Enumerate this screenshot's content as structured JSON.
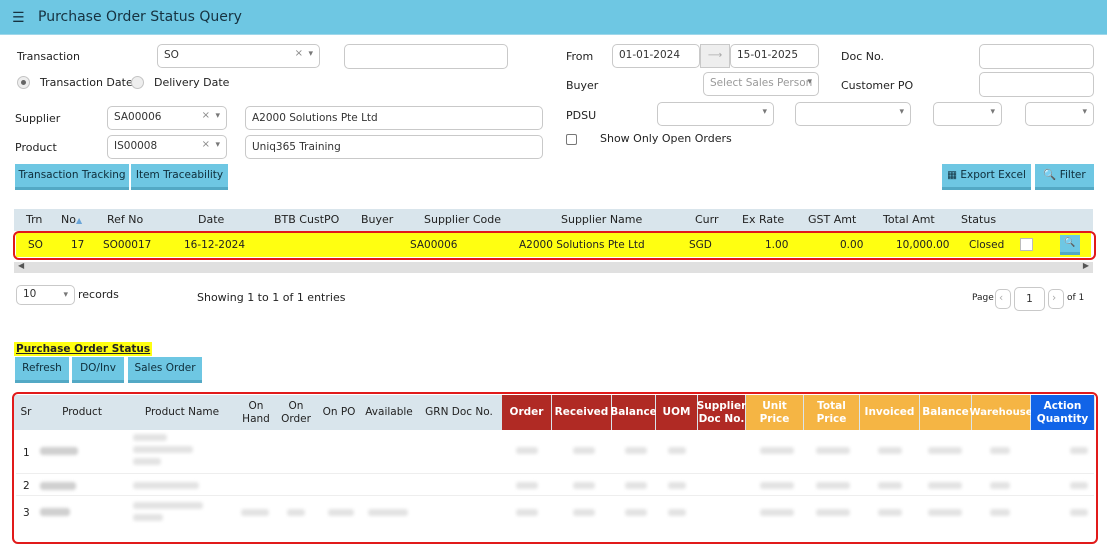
{
  "header": {
    "title": "Purchase Order Status Query",
    "menu_icon": "hamburger-icon"
  },
  "filters": {
    "transaction_label": "Transaction",
    "transaction_value": "SO",
    "date_type_transaction": "Transaction Date",
    "date_type_delivery": "Delivery Date",
    "from_label": "From",
    "from_value": "01-01-2024",
    "to_value": "15-01-2025",
    "doc_no_label": "Doc No.",
    "buyer_label": "Buyer",
    "buyer_placeholder": "Select Sales Person",
    "customer_po_label": "Customer PO",
    "supplier_label": "Supplier",
    "supplier_code": "SA00006",
    "supplier_name": "A2000 Solutions Pte Ltd",
    "product_label": "Product",
    "product_code": "IS00008",
    "product_name": "Uniq365 Training",
    "pdsu_label": "PDSU",
    "show_open_label": "Show Only Open Orders"
  },
  "toolbar": {
    "transaction_tracking": "Transaction Tracking",
    "item_traceability": "Item Traceability",
    "export_excel": "Export Excel",
    "filter": "Filter"
  },
  "grid": {
    "columns": [
      "Trn",
      "No",
      "Ref No",
      "Date",
      "BTB CustPO",
      "Buyer",
      "Supplier Code",
      "Supplier Name",
      "Curr",
      "Ex Rate",
      "GST Amt",
      "Total Amt",
      "Status"
    ],
    "row": {
      "trn": "SO",
      "no": "17",
      "ref_no": "SO00017",
      "date": "16-12-2024",
      "btb": "",
      "buyer": "",
      "supplier_code": "SA00006",
      "supplier_name": "A2000 Solutions Pte Ltd",
      "curr": "SGD",
      "ex_rate": "1.00",
      "gst_amt": "0.00",
      "total_amt": "10,000.00",
      "status": "Closed"
    },
    "page_size": "10",
    "records_label": "records",
    "showing": "Showing 1 to 1 of 1 entries",
    "page_label": "Page",
    "page_value": "1",
    "of_label": "of 1"
  },
  "status_section": {
    "title": "Purchase Order Status",
    "refresh": "Refresh",
    "do_inv": "DO/Inv",
    "sales_order": "Sales Order",
    "columns": {
      "sr": "Sr",
      "product": "Product",
      "product_name": "Product Name",
      "on_hand": "On Hand",
      "on_order": "On Order",
      "on_po": "On PO",
      "available": "Available",
      "grn_doc": "GRN Doc No.",
      "order": "Order",
      "received": "Received",
      "balance": "Balance",
      "uom": "UOM",
      "supplier_doc": "Supplier Doc No.",
      "unit_price": "Unit Price",
      "total_price": "Total Price",
      "invoiced": "Invoiced",
      "balance2": "Balance",
      "warehouse": "Warehouse",
      "action_qty": "Action Quantity"
    },
    "rows": [
      {
        "sr": "1"
      },
      {
        "sr": "2"
      },
      {
        "sr": "3"
      }
    ]
  },
  "colors": {
    "accent": "#6ec7e3",
    "selected_row": "#ffff11",
    "highlight_outline": "#e11a1a",
    "received_group": "#b02a24",
    "invoice_group": "#f5b544",
    "action_group": "#1164e8"
  }
}
